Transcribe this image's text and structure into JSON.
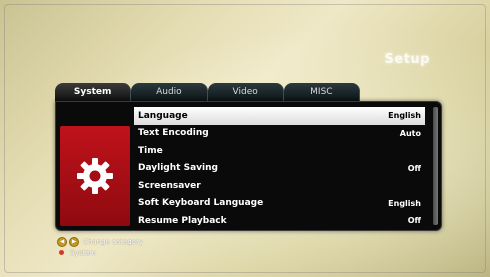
{
  "header": {
    "title": "Setup"
  },
  "tabs": [
    {
      "label": "System",
      "active": true
    },
    {
      "label": "Audio",
      "active": false
    },
    {
      "label": "Video",
      "active": false
    },
    {
      "label": "MISC",
      "active": false
    }
  ],
  "panel_icon": "gear-icon",
  "menu": [
    {
      "label": "Language",
      "value": "English",
      "selected": true
    },
    {
      "label": "Text Encoding",
      "value": "Auto"
    },
    {
      "label": "Time",
      "value": ""
    },
    {
      "label": "Daylight Saving",
      "value": "Off"
    },
    {
      "label": "Screensaver",
      "value": ""
    },
    {
      "label": "Soft Keyboard Language",
      "value": "English"
    },
    {
      "label": "Resume Playback",
      "value": "Off"
    }
  ],
  "hints": {
    "left_key": "◀",
    "right_key": "▶",
    "change_category": "Change category",
    "system": "System"
  },
  "colors": {
    "accent_red": "#c0121b",
    "selected_bg": "#ffffff",
    "panel_bg": "#0a0a0a"
  }
}
